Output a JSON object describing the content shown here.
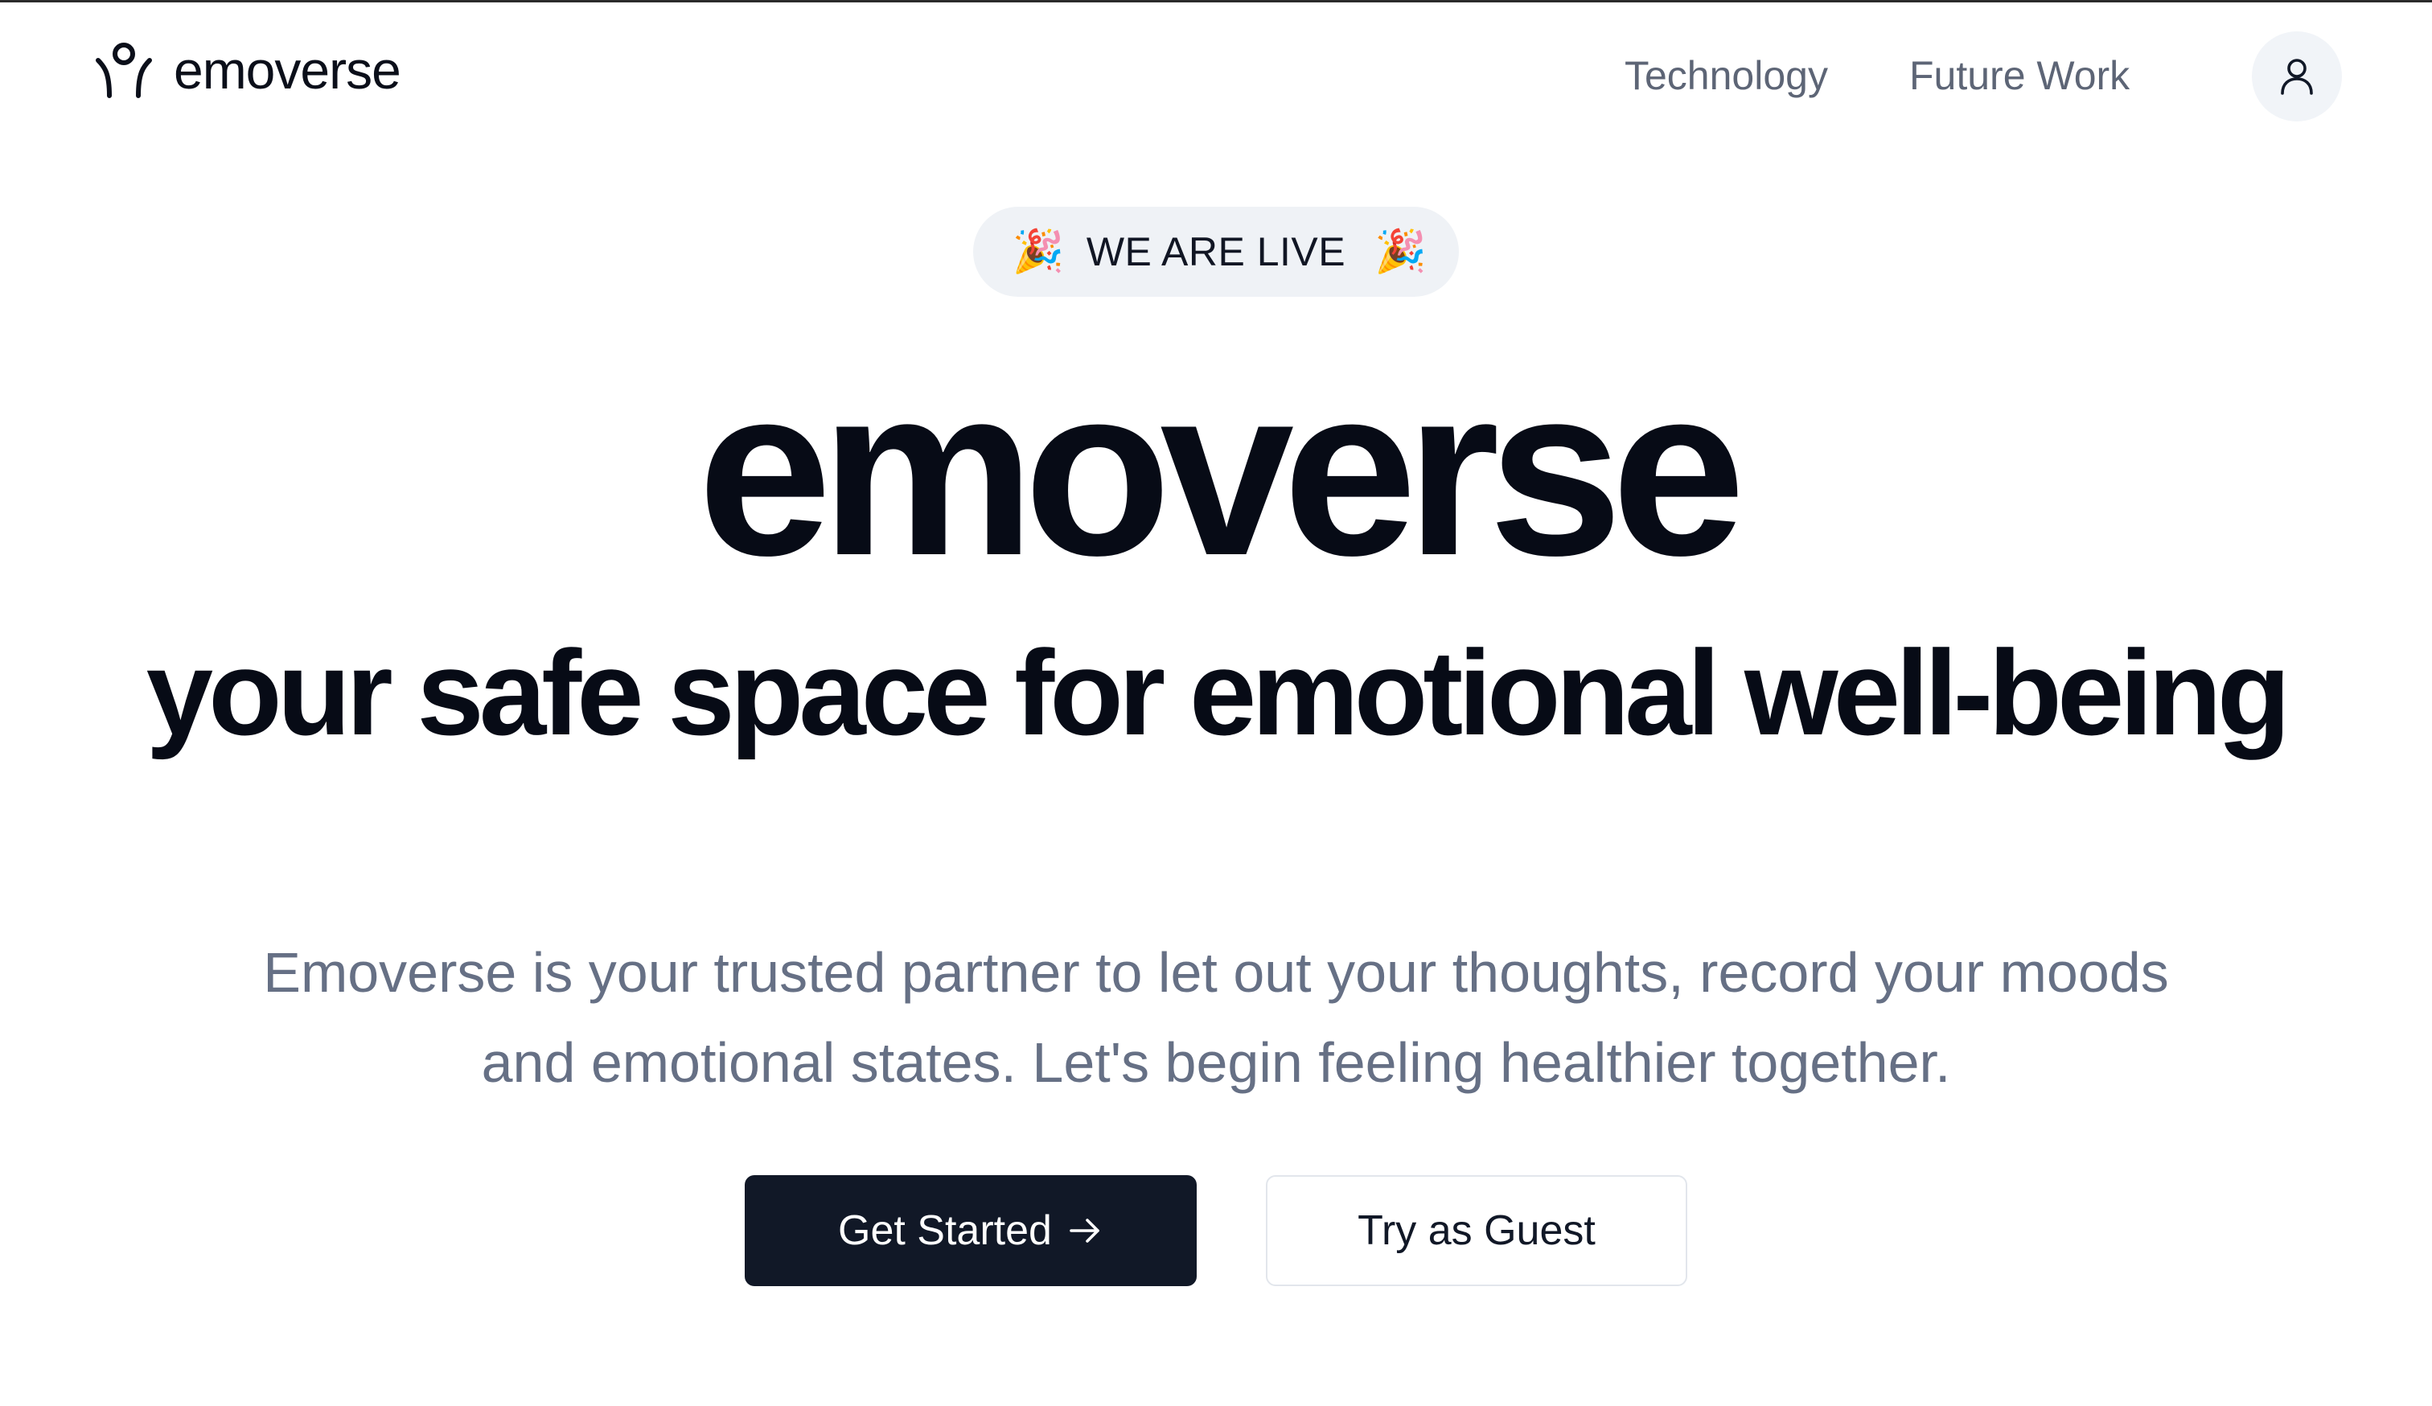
{
  "header": {
    "brand_name": "emoverse",
    "nav": {
      "technology": "Technology",
      "future_work": "Future Work"
    },
    "account_icon": "user-icon",
    "logo_icon": "person-raising-arms-icon"
  },
  "badge": {
    "text": "WE ARE LIVE",
    "icon_left": "🎉",
    "icon_right": "🎉",
    "icon_name": "party-popper-icon"
  },
  "hero": {
    "title": "emoverse",
    "subtitle": "your safe space for emotional well-being",
    "description": "Emoverse is your trusted partner to let out your thoughts, record your moods and emotional states. Let's begin feeling healthier together."
  },
  "actions": {
    "primary_label": "Get Started",
    "primary_icon": "arrow-right-icon",
    "secondary_label": "Try as Guest"
  },
  "colors": {
    "text_dark": "#070b16",
    "text_muted": "#667085",
    "nav_text": "#5d6576",
    "badge_bg": "#eff2f6",
    "primary_button_bg": "#111827",
    "account_button_bg": "#f1f4f8"
  }
}
